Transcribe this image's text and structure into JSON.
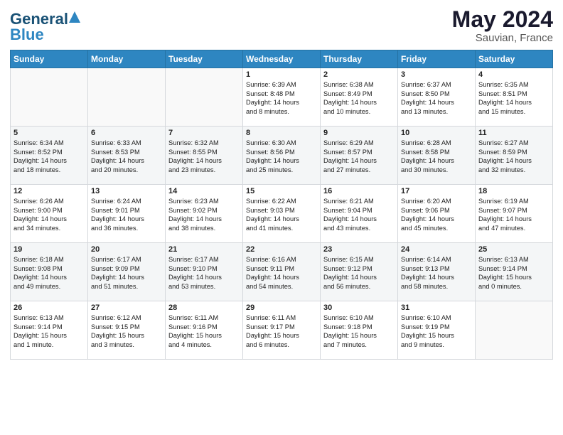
{
  "logo": {
    "line1": "General",
    "line2": "Blue"
  },
  "title": "May 2024",
  "location": "Sauvian, France",
  "headers": [
    "Sunday",
    "Monday",
    "Tuesday",
    "Wednesday",
    "Thursday",
    "Friday",
    "Saturday"
  ],
  "weeks": [
    [
      {
        "day": "",
        "content": ""
      },
      {
        "day": "",
        "content": ""
      },
      {
        "day": "",
        "content": ""
      },
      {
        "day": "1",
        "content": "Sunrise: 6:39 AM\nSunset: 8:48 PM\nDaylight: 14 hours\nand 8 minutes."
      },
      {
        "day": "2",
        "content": "Sunrise: 6:38 AM\nSunset: 8:49 PM\nDaylight: 14 hours\nand 10 minutes."
      },
      {
        "day": "3",
        "content": "Sunrise: 6:37 AM\nSunset: 8:50 PM\nDaylight: 14 hours\nand 13 minutes."
      },
      {
        "day": "4",
        "content": "Sunrise: 6:35 AM\nSunset: 8:51 PM\nDaylight: 14 hours\nand 15 minutes."
      }
    ],
    [
      {
        "day": "5",
        "content": "Sunrise: 6:34 AM\nSunset: 8:52 PM\nDaylight: 14 hours\nand 18 minutes."
      },
      {
        "day": "6",
        "content": "Sunrise: 6:33 AM\nSunset: 8:53 PM\nDaylight: 14 hours\nand 20 minutes."
      },
      {
        "day": "7",
        "content": "Sunrise: 6:32 AM\nSunset: 8:55 PM\nDaylight: 14 hours\nand 23 minutes."
      },
      {
        "day": "8",
        "content": "Sunrise: 6:30 AM\nSunset: 8:56 PM\nDaylight: 14 hours\nand 25 minutes."
      },
      {
        "day": "9",
        "content": "Sunrise: 6:29 AM\nSunset: 8:57 PM\nDaylight: 14 hours\nand 27 minutes."
      },
      {
        "day": "10",
        "content": "Sunrise: 6:28 AM\nSunset: 8:58 PM\nDaylight: 14 hours\nand 30 minutes."
      },
      {
        "day": "11",
        "content": "Sunrise: 6:27 AM\nSunset: 8:59 PM\nDaylight: 14 hours\nand 32 minutes."
      }
    ],
    [
      {
        "day": "12",
        "content": "Sunrise: 6:26 AM\nSunset: 9:00 PM\nDaylight: 14 hours\nand 34 minutes."
      },
      {
        "day": "13",
        "content": "Sunrise: 6:24 AM\nSunset: 9:01 PM\nDaylight: 14 hours\nand 36 minutes."
      },
      {
        "day": "14",
        "content": "Sunrise: 6:23 AM\nSunset: 9:02 PM\nDaylight: 14 hours\nand 38 minutes."
      },
      {
        "day": "15",
        "content": "Sunrise: 6:22 AM\nSunset: 9:03 PM\nDaylight: 14 hours\nand 41 minutes."
      },
      {
        "day": "16",
        "content": "Sunrise: 6:21 AM\nSunset: 9:04 PM\nDaylight: 14 hours\nand 43 minutes."
      },
      {
        "day": "17",
        "content": "Sunrise: 6:20 AM\nSunset: 9:06 PM\nDaylight: 14 hours\nand 45 minutes."
      },
      {
        "day": "18",
        "content": "Sunrise: 6:19 AM\nSunset: 9:07 PM\nDaylight: 14 hours\nand 47 minutes."
      }
    ],
    [
      {
        "day": "19",
        "content": "Sunrise: 6:18 AM\nSunset: 9:08 PM\nDaylight: 14 hours\nand 49 minutes."
      },
      {
        "day": "20",
        "content": "Sunrise: 6:17 AM\nSunset: 9:09 PM\nDaylight: 14 hours\nand 51 minutes."
      },
      {
        "day": "21",
        "content": "Sunrise: 6:17 AM\nSunset: 9:10 PM\nDaylight: 14 hours\nand 53 minutes."
      },
      {
        "day": "22",
        "content": "Sunrise: 6:16 AM\nSunset: 9:11 PM\nDaylight: 14 hours\nand 54 minutes."
      },
      {
        "day": "23",
        "content": "Sunrise: 6:15 AM\nSunset: 9:12 PM\nDaylight: 14 hours\nand 56 minutes."
      },
      {
        "day": "24",
        "content": "Sunrise: 6:14 AM\nSunset: 9:13 PM\nDaylight: 14 hours\nand 58 minutes."
      },
      {
        "day": "25",
        "content": "Sunrise: 6:13 AM\nSunset: 9:14 PM\nDaylight: 15 hours\nand 0 minutes."
      }
    ],
    [
      {
        "day": "26",
        "content": "Sunrise: 6:13 AM\nSunset: 9:14 PM\nDaylight: 15 hours\nand 1 minute."
      },
      {
        "day": "27",
        "content": "Sunrise: 6:12 AM\nSunset: 9:15 PM\nDaylight: 15 hours\nand 3 minutes."
      },
      {
        "day": "28",
        "content": "Sunrise: 6:11 AM\nSunset: 9:16 PM\nDaylight: 15 hours\nand 4 minutes."
      },
      {
        "day": "29",
        "content": "Sunrise: 6:11 AM\nSunset: 9:17 PM\nDaylight: 15 hours\nand 6 minutes."
      },
      {
        "day": "30",
        "content": "Sunrise: 6:10 AM\nSunset: 9:18 PM\nDaylight: 15 hours\nand 7 minutes."
      },
      {
        "day": "31",
        "content": "Sunrise: 6:10 AM\nSunset: 9:19 PM\nDaylight: 15 hours\nand 9 minutes."
      },
      {
        "day": "",
        "content": ""
      }
    ]
  ]
}
